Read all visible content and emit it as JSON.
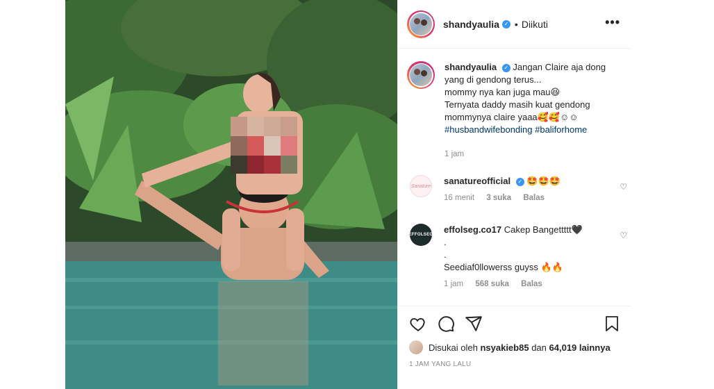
{
  "post": {
    "username": "shandyaulia",
    "follow_status": "Diikuti",
    "more_label": "•••",
    "verified_glyph": "✓",
    "caption_lines": [
      "Jangan Claire aja dong",
      "yang di gendong terus...",
      "mommy nya kan juga mau😆",
      "Ternyata daddy masih kuat gendong",
      "mommynya claire yaaa🥰🥰☺☺"
    ],
    "hashtags": "#husbandwifebonding #baliforhome",
    "caption_time": "1 jam",
    "photo_description_icon": "photo"
  },
  "comments": [
    {
      "username": "sanatureofficial",
      "verified": true,
      "avatar_text": "Sanature",
      "text": "🤩🤩🤩",
      "time": "16 menit",
      "likes": "3 suka",
      "reply": "Balas"
    },
    {
      "username": "effolseg.co17",
      "verified": false,
      "avatar_text": "EFFOLSEG",
      "text": "Cakep Bangettttt🖤",
      "lines": [
        ".",
        ".",
        "Seediaf0llowerss guyss 🔥🔥"
      ],
      "time": "1 jam",
      "likes": "568 suka",
      "reply": "Balas"
    }
  ],
  "actions": {
    "liked_by_prefix": "Disukai oleh",
    "liked_by_user": "nsyakieb85",
    "and": "dan",
    "others": "64,019 lainnya",
    "timestamp": "1 JAM YANG LALU"
  },
  "icons": {
    "like": "heart-icon",
    "comment": "comment-icon",
    "share": "share-icon",
    "save": "bookmark-icon",
    "more": "more-options-icon"
  }
}
